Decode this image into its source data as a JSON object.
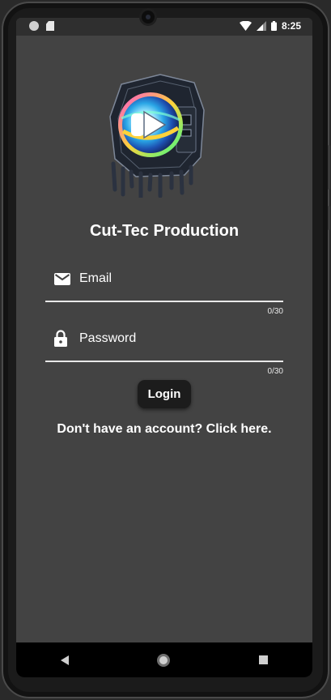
{
  "status_bar": {
    "time": "8:25",
    "icons": [
      "notification-dot-icon",
      "sd-card-icon",
      "wifi-icon",
      "cellular-signal-icon",
      "battery-icon"
    ]
  },
  "app": {
    "title": "Cut-Tec Production"
  },
  "form": {
    "email": {
      "label": "Email",
      "counter": "0/30",
      "icon": "email-icon"
    },
    "password": {
      "label": "Password",
      "counter": "0/30",
      "icon": "lock-icon"
    },
    "login_label": "Login",
    "signup_text": "Don't have an account? Click here."
  },
  "nav_bar": {
    "icons": [
      "back-icon",
      "home-icon",
      "recent-apps-icon"
    ]
  },
  "colors": {
    "screen_bg": "#434343",
    "button_bg": "#1c1c1c",
    "text": "#ffffff"
  }
}
